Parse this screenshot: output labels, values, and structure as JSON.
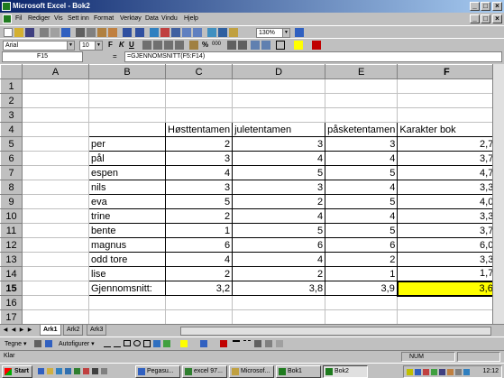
{
  "window": {
    "title": "Microsoft Excel - Bok2",
    "controls": [
      "_",
      "□",
      "×"
    ]
  },
  "menu": [
    "Fil",
    "Rediger",
    "Vis",
    "Sett inn",
    "Format",
    "Verktøy",
    "Data",
    "Vindu",
    "Hjelp"
  ],
  "toolbar": {
    "zoom": "130%",
    "font": "Arial",
    "font_size": "10",
    "bold": "F",
    "italic": "K",
    "underline": "U",
    "percent": "%",
    "thousands": "000"
  },
  "formula": {
    "cell_ref": "F15",
    "eq": "=",
    "content": "=GJENNOMSNITT(F5:F14)"
  },
  "grid": {
    "columns": [
      "A",
      "B",
      "C",
      "D",
      "E",
      "F"
    ],
    "rows": [
      "1",
      "2",
      "3",
      "4",
      "5",
      "6",
      "7",
      "8",
      "9",
      "10",
      "11",
      "12",
      "13",
      "14",
      "15",
      "16",
      "17"
    ],
    "selected_cell": "F15",
    "highlight_color": "#ffff00",
    "headers": [
      "Høsttentamen",
      "juletentamen",
      "påsketentamen",
      "Karakter bok"
    ],
    "students": [
      {
        "name": "per",
        "h": "2",
        "j": "3",
        "p": "3",
        "k": "2,7"
      },
      {
        "name": "pål",
        "h": "3",
        "j": "4",
        "p": "4",
        "k": "3,7"
      },
      {
        "name": "espen",
        "h": "4",
        "j": "5",
        "p": "5",
        "k": "4,7"
      },
      {
        "name": "nils",
        "h": "3",
        "j": "3",
        "p": "4",
        "k": "3,3"
      },
      {
        "name": "eva",
        "h": "5",
        "j": "2",
        "p": "5",
        "k": "4,0"
      },
      {
        "name": "trine",
        "h": "2",
        "j": "4",
        "p": "4",
        "k": "3,3"
      },
      {
        "name": "bente",
        "h": "1",
        "j": "5",
        "p": "5",
        "k": "3,7"
      },
      {
        "name": "magnus",
        "h": "6",
        "j": "6",
        "p": "6",
        "k": "6,0"
      },
      {
        "name": "odd tore",
        "h": "4",
        "j": "4",
        "p": "2",
        "k": "3,3"
      },
      {
        "name": "lise",
        "h": "2",
        "j": "2",
        "p": "1",
        "k": "1,7"
      }
    ],
    "average": {
      "label": "Gjennomsnitt:",
      "h": "3,2",
      "j": "3,8",
      "p": "3,9",
      "k": "3,6"
    }
  },
  "sheets": [
    "Ark1",
    "Ark2",
    "Ark3"
  ],
  "drawbar": {
    "draw": "Tegne ▾",
    "autoshapes": "Autofigurer ▾"
  },
  "status": {
    "ready": "Klar",
    "num": "NUM"
  },
  "taskbar": {
    "start": "Start",
    "items": [
      "Pegasu...",
      "excel 97...",
      "Microsof...",
      "Bok1",
      "Bok2"
    ],
    "active": "Bok2",
    "clock": "12:12"
  }
}
